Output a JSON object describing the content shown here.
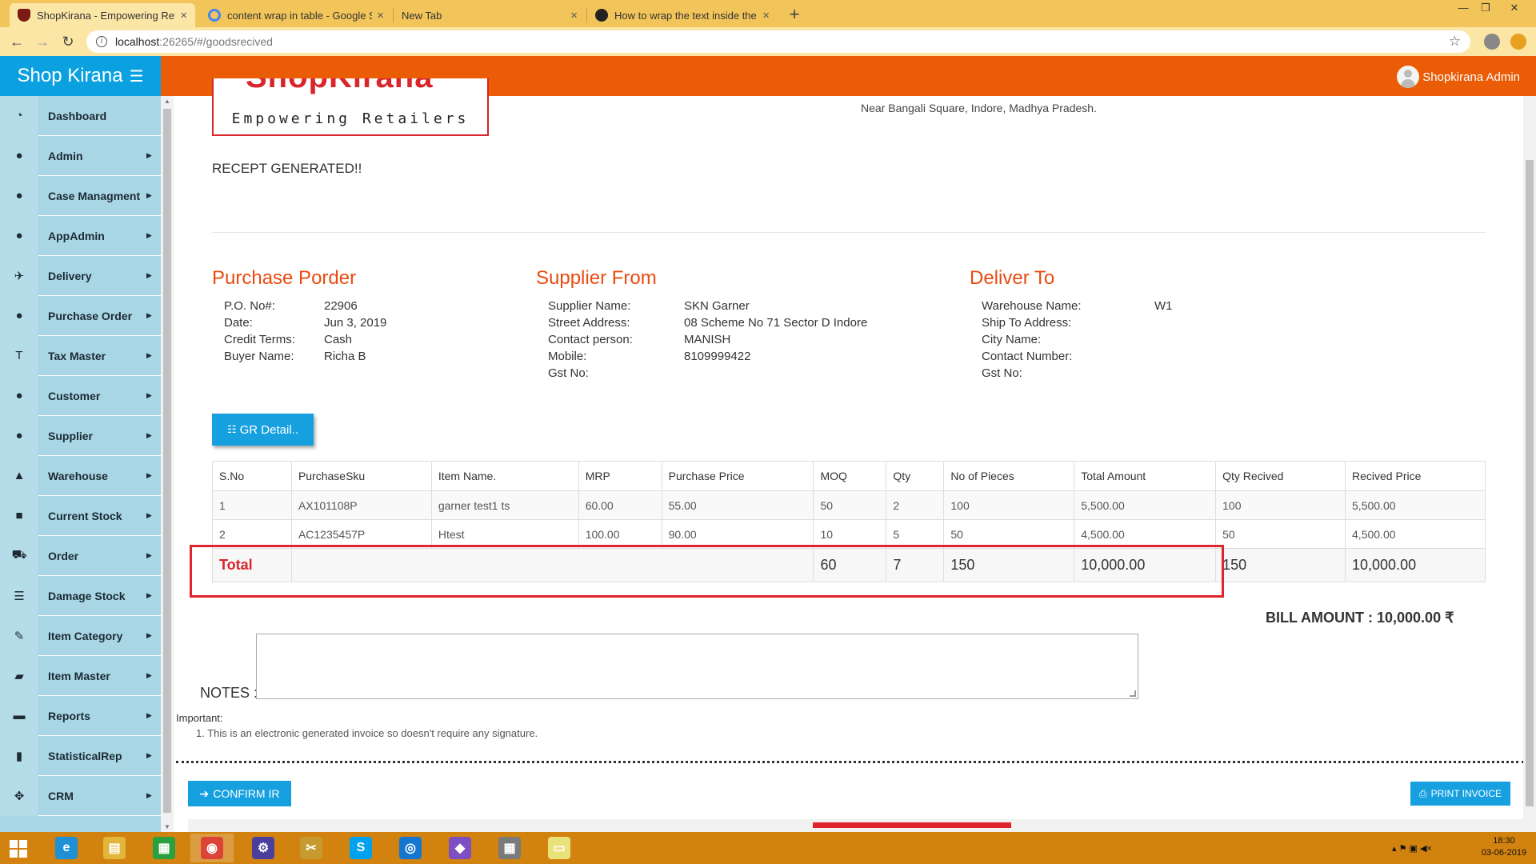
{
  "browser": {
    "tabs": [
      {
        "label": "ShopKirana - Empowering Retailers",
        "icon": "shopkirana-favicon"
      },
      {
        "label": "content wrap in table - Google Search",
        "icon": "google-icon"
      },
      {
        "label": "New Tab",
        "icon": ""
      },
      {
        "label": "How to wrap the text inside the table",
        "icon": "github-icon"
      }
    ],
    "close_glyph": "×",
    "new_tab_glyph": "+",
    "url_host": "localhost",
    "url_path": ":26265/#/goodsrecived"
  },
  "app": {
    "brand": "Shop Kirana",
    "user_name": "Shopkirana Admin"
  },
  "sidebar": {
    "items": [
      {
        "label": "Dashboard",
        "icon": "dashboard-icon",
        "glyph": "◔",
        "arrow": ""
      },
      {
        "label": "Admin",
        "icon": "user-icon",
        "glyph": "●",
        "arrow": "▶"
      },
      {
        "label": "Case Managment",
        "icon": "user-icon",
        "glyph": "●",
        "arrow": "▶"
      },
      {
        "label": "AppAdmin",
        "icon": "user-icon",
        "glyph": "●",
        "arrow": "▶"
      },
      {
        "label": "Delivery",
        "icon": "plane-icon",
        "glyph": "✈",
        "arrow": "▶"
      },
      {
        "label": "Purchase Order",
        "icon": "user-icon",
        "glyph": "●",
        "arrow": "▶"
      },
      {
        "label": "Tax Master",
        "icon": "text-icon",
        "glyph": "T",
        "arrow": "▶"
      },
      {
        "label": "Customer",
        "icon": "user-icon",
        "glyph": "●",
        "arrow": "▶"
      },
      {
        "label": "Supplier",
        "icon": "user-icon",
        "glyph": "●",
        "arrow": "▶"
      },
      {
        "label": "Warehouse",
        "icon": "road-icon",
        "glyph": "▲",
        "arrow": "▶"
      },
      {
        "label": "Current Stock",
        "icon": "folder-icon",
        "glyph": "■",
        "arrow": "▶"
      },
      {
        "label": "Order",
        "icon": "cart-icon",
        "glyph": "⛟",
        "arrow": "▶"
      },
      {
        "label": "Damage Stock",
        "icon": "tasks-icon",
        "glyph": "☰",
        "arrow": "▶"
      },
      {
        "label": "Item Category",
        "icon": "pencil-icon",
        "glyph": "✎",
        "arrow": "▶"
      },
      {
        "label": "Item Master",
        "icon": "folder-open-icon",
        "glyph": "▰",
        "arrow": "▶"
      },
      {
        "label": "Reports",
        "icon": "briefcase-icon",
        "glyph": "▬",
        "arrow": "▶"
      },
      {
        "label": "StatisticalRep",
        "icon": "bar-chart-icon",
        "glyph": "▮",
        "arrow": "▶"
      },
      {
        "label": "CRM",
        "icon": "move-icon",
        "glyph": "✥",
        "arrow": "▶"
      }
    ]
  },
  "header": {
    "logo_big": "ShopKirana",
    "logo_tagline": "Empowering Retailers",
    "address_line": "Near Bangali Square, Indore, Madhya Pradesh."
  },
  "receipt_message": "RECEPT GENERATED!!",
  "purchase_order": {
    "title": "Purchase Porder",
    "rows": [
      {
        "k": "P.O. No#:",
        "v": "22906"
      },
      {
        "k": "Date:",
        "v": "Jun 3, 2019"
      },
      {
        "k": "Credit Terms:",
        "v": "Cash"
      },
      {
        "k": "Buyer Name:",
        "v": "Richa B"
      }
    ]
  },
  "supplier": {
    "title": "Supplier From",
    "rows": [
      {
        "k": "Supplier Name:",
        "v": "SKN Garner"
      },
      {
        "k": "Street Address:",
        "v": "08 Scheme No 71 Sector D Indore"
      },
      {
        "k": "Contact person:",
        "v": "MANISH"
      },
      {
        "k": "Mobile:",
        "v": "8109999422"
      },
      {
        "k": "Gst No:",
        "v": ""
      }
    ]
  },
  "deliver_to": {
    "title": "Deliver To",
    "rows": [
      {
        "k": "Warehouse Name:",
        "v": "W1"
      },
      {
        "k": "Ship To Address:",
        "v": ""
      },
      {
        "k": "City Name:",
        "v": ""
      },
      {
        "k": "Contact Number:",
        "v": ""
      },
      {
        "k": "Gst No:",
        "v": ""
      }
    ]
  },
  "gr_button": {
    "label": "GR Detail..",
    "icon": "list-icon"
  },
  "table": {
    "headers": [
      "S.No",
      "PurchaseSku",
      "Item Name.",
      "MRP",
      "Purchase Price",
      "MOQ",
      "Qty",
      "No of Pieces",
      "Total Amount",
      "Qty Recived",
      "Recived Price"
    ],
    "rows": [
      [
        "1",
        "AX101108P",
        "garner test1 ts",
        "60.00",
        "55.00",
        "50",
        "2",
        "100",
        "5,500.00",
        "100",
        "5,500.00"
      ],
      [
        "2",
        "AC1235457P",
        "Htest",
        "100.00",
        "90.00",
        "10",
        "5",
        "50",
        "4,500.00",
        "50",
        "4,500.00"
      ]
    ],
    "total": {
      "label": "Total",
      "moq": "60",
      "qty": "7",
      "pieces": "150",
      "amount": "10,000.00",
      "qty_recived": "150",
      "recived_price": "10,000.00"
    }
  },
  "bill": {
    "label": "BILL AMOUNT :",
    "amount": "10,000.00 ₹"
  },
  "notes": {
    "label": "NOTES :",
    "value": ""
  },
  "important": {
    "title": "Important:",
    "note": "1. This is an electronic generated invoice so doesn't require any signature."
  },
  "actions": {
    "confirm": "CONFIRM IR",
    "print": "PRINT INVOICE"
  },
  "taskbar": {
    "apps": [
      {
        "name": "ie-icon",
        "glyph": "e",
        "color": "#1e90d6"
      },
      {
        "name": "file-explorer-icon",
        "glyph": "▤",
        "color": "#e2b53b"
      },
      {
        "name": "store-icon",
        "glyph": "▦",
        "color": "#2aa13f"
      },
      {
        "name": "chrome-icon",
        "glyph": "◉",
        "color": "#db4437"
      },
      {
        "name": "settings-icon",
        "glyph": "⚙",
        "color": "#4b3f9e"
      },
      {
        "name": "tools-icon",
        "glyph": "✂",
        "color": "#c79a30"
      },
      {
        "name": "skype-icon",
        "glyph": "S",
        "color": "#00a2ed"
      },
      {
        "name": "maps-icon",
        "glyph": "◎",
        "color": "#1476d0"
      },
      {
        "name": "visual-studio-icon",
        "glyph": "◆",
        "color": "#7d4fc2"
      },
      {
        "name": "calculator-icon",
        "glyph": "▦",
        "color": "#7a7a7a"
      },
      {
        "name": "sticky-notes-icon",
        "glyph": "▭",
        "color": "#e9e27a"
      }
    ],
    "time": "18:30",
    "date": "03-06-2019"
  }
}
